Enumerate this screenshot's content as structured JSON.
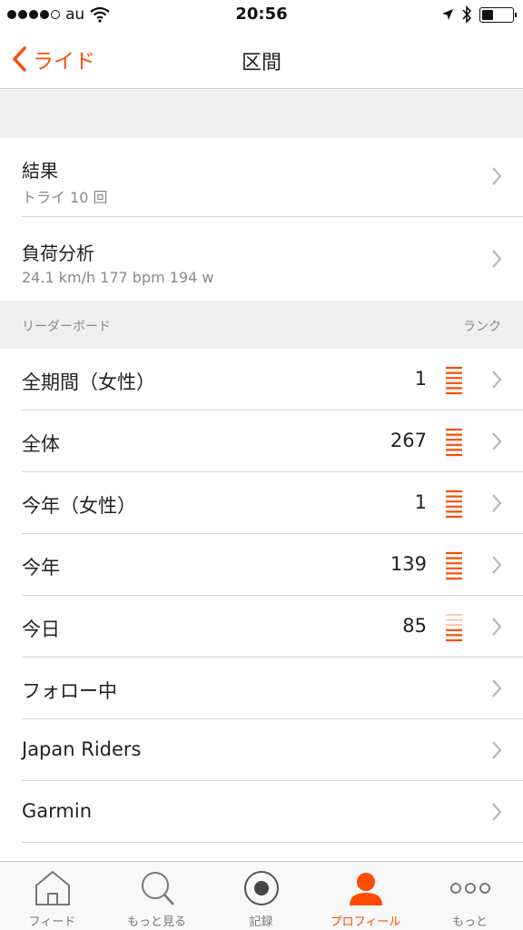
{
  "status_bar": {
    "carrier": "au",
    "time": "20:56"
  },
  "nav": {
    "back_label": "ライド",
    "title": "区間"
  },
  "results": {
    "title": "結果",
    "subtitle": "トライ 10 回"
  },
  "power_analysis": {
    "title": "負荷分析",
    "subtitle": "24.1 km/h 177 bpm 194 w"
  },
  "leaderboard": {
    "header_left": "リーダーボード",
    "header_right": "ランク",
    "rows": [
      {
        "label": "全期間（女性）",
        "rank": "1",
        "rank_level": 1.0
      },
      {
        "label": "全体",
        "rank": "267",
        "rank_level": 1.0
      },
      {
        "label": "今年（女性）",
        "rank": "1",
        "rank_level": 1.0
      },
      {
        "label": "今年",
        "rank": "139",
        "rank_level": 1.0
      },
      {
        "label": "今日",
        "rank": "85",
        "rank_level": 0.5
      },
      {
        "label": "フォロー中",
        "rank": "",
        "rank_level": null
      },
      {
        "label": "Japan Riders",
        "rank": "",
        "rank_level": null
      },
      {
        "label": "Garmin",
        "rank": "",
        "rank_level": null
      }
    ]
  },
  "tabs": [
    {
      "label": "フィード",
      "icon": "home-icon",
      "active": false
    },
    {
      "label": "もっと見る",
      "icon": "search-icon",
      "active": false
    },
    {
      "label": "記録",
      "icon": "record-icon",
      "active": false
    },
    {
      "label": "プロフィール",
      "icon": "profile-icon",
      "active": true
    },
    {
      "label": "もっと",
      "icon": "more-icon",
      "active": false
    }
  ],
  "colors": {
    "accent": "#fc4c02",
    "rank_bar_active": "#fc4c02",
    "rank_bar_inactive": "#f9b9a0"
  }
}
